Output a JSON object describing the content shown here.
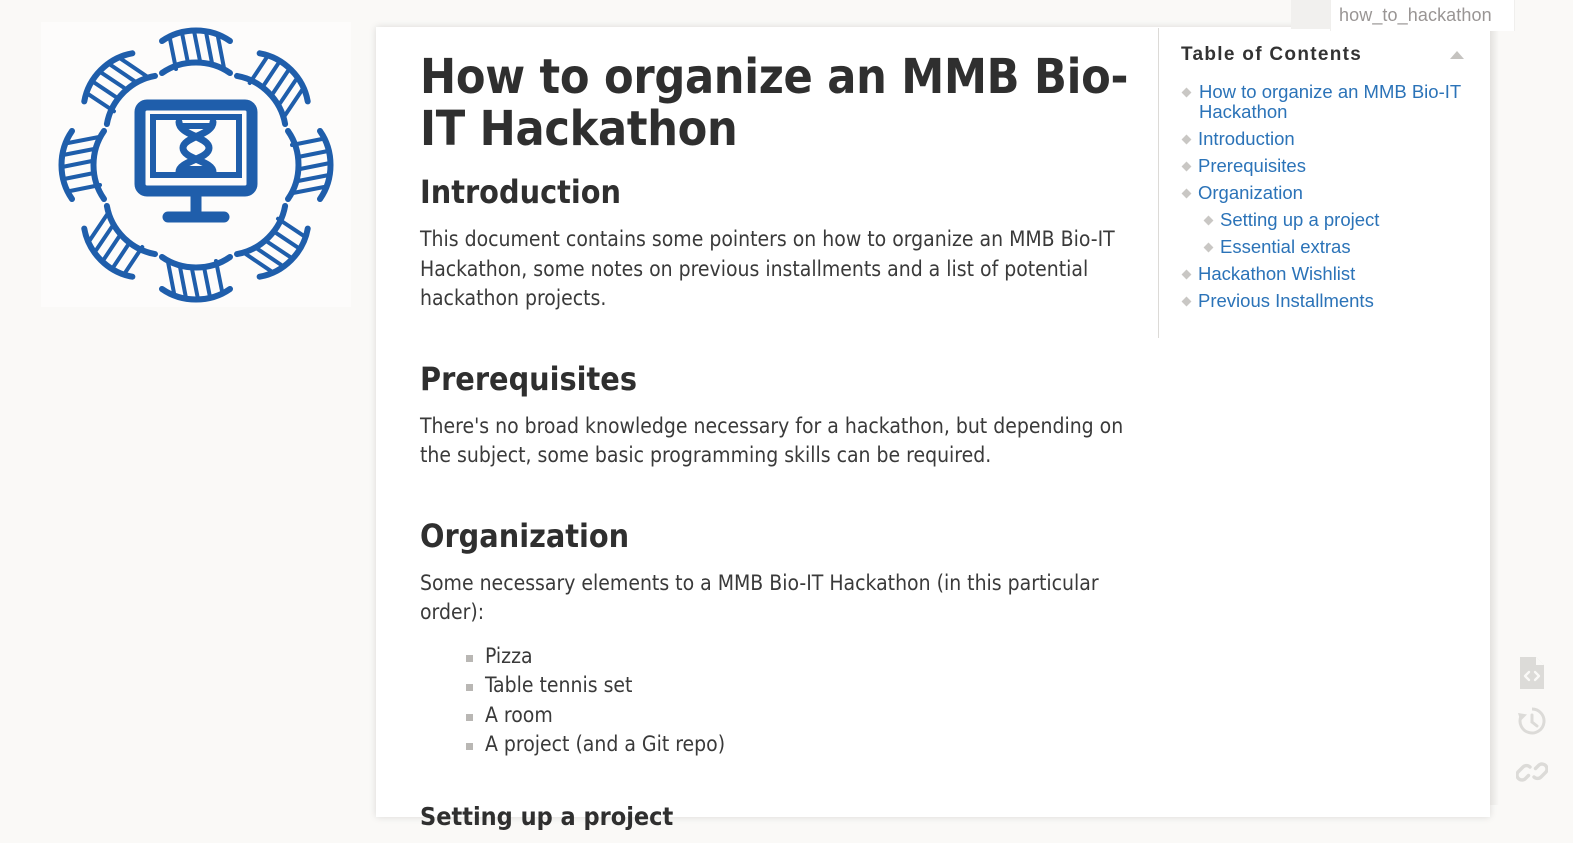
{
  "pagename": {
    "label": "how_to_hackathon"
  },
  "logo": {
    "name": "mmb-bio-it-dna-monitor-logo",
    "color": "#1f5eab"
  },
  "toc": {
    "title": "Table of Contents",
    "toggle_icon": "chevron-up-icon",
    "items": [
      {
        "label": "How to organize an MMB Bio-IT Hackathon",
        "level": 1
      },
      {
        "label": "Introduction",
        "level": 2
      },
      {
        "label": "Prerequisites",
        "level": 2
      },
      {
        "label": "Organization",
        "level": 2
      },
      {
        "label": "Setting up a project",
        "level": 3
      },
      {
        "label": "Essential extras",
        "level": 3
      },
      {
        "label": "Hackathon Wishlist",
        "level": 2
      },
      {
        "label": "Previous Installments",
        "level": 2
      }
    ],
    "link_color": "#2b73b8"
  },
  "article": {
    "title": "How to organize an MMB Bio-IT Hackathon",
    "sections": {
      "introduction": {
        "heading": "Introduction",
        "paragraph": "This document contains some pointers on how to organize an MMB Bio-IT Hackathon, some notes on previous installments and a list of potential hackathon projects."
      },
      "prerequisites": {
        "heading": "Prerequisites",
        "paragraph": "There's no broad knowledge necessary for a hackathon, but depending on the subject, some basic programming skills can be required."
      },
      "organization": {
        "heading": "Organization",
        "paragraph": "Some necessary elements to a MMB Bio-IT Hackathon (in this particular order):",
        "list": [
          "Pizza",
          "Table tennis set",
          "A room",
          "A project (and a Git repo)"
        ]
      },
      "setting_up": {
        "heading": "Setting up a project"
      }
    }
  },
  "rail": {
    "buttons": [
      {
        "name": "show-pagesource-icon",
        "label": "Show pagesource"
      },
      {
        "name": "old-revisions-icon",
        "label": "Old revisions"
      },
      {
        "name": "backlinks-icon",
        "label": "Backlinks"
      }
    ]
  }
}
